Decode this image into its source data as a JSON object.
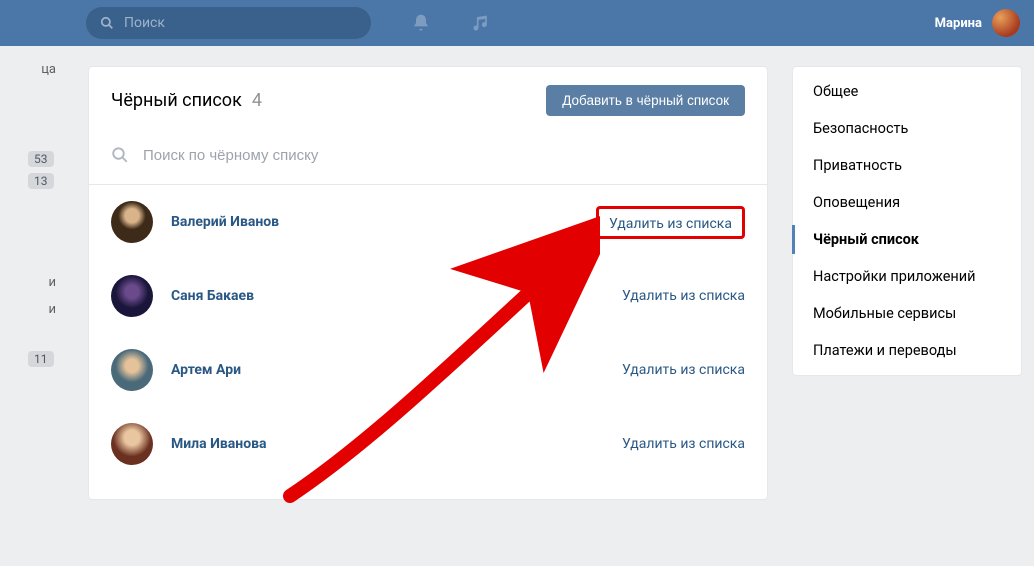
{
  "topbar": {
    "search_placeholder": "Поиск",
    "user_name": "Марина"
  },
  "left_rail": {
    "text1": "ца",
    "badge1": "53",
    "badge2": "13",
    "text2": "и",
    "text3": "и",
    "badge3": "11"
  },
  "panel": {
    "title": "Чёрный список",
    "count": "4",
    "add_button": "Добавить в чёрный список",
    "search_placeholder": "Поиск по чёрному списку"
  },
  "list": [
    {
      "name": "Валерий Иванов",
      "remove": "Удалить из списка",
      "highlighted": true
    },
    {
      "name": "Саня Бакаев",
      "remove": "Удалить из списка",
      "highlighted": false
    },
    {
      "name": "Артем Ари",
      "remove": "Удалить из списка",
      "highlighted": false
    },
    {
      "name": "Мила Иванова",
      "remove": "Удалить из списка",
      "highlighted": false
    }
  ],
  "sidebar": {
    "items": [
      {
        "label": "Общее"
      },
      {
        "label": "Безопасность"
      },
      {
        "label": "Приватность"
      },
      {
        "label": "Оповещения"
      },
      {
        "label": "Чёрный список",
        "active": true
      },
      {
        "label": "Настройки приложений"
      },
      {
        "label": "Мобильные сервисы"
      },
      {
        "label": "Платежи и переводы"
      }
    ]
  },
  "annotation": {
    "color": "#e30000"
  }
}
